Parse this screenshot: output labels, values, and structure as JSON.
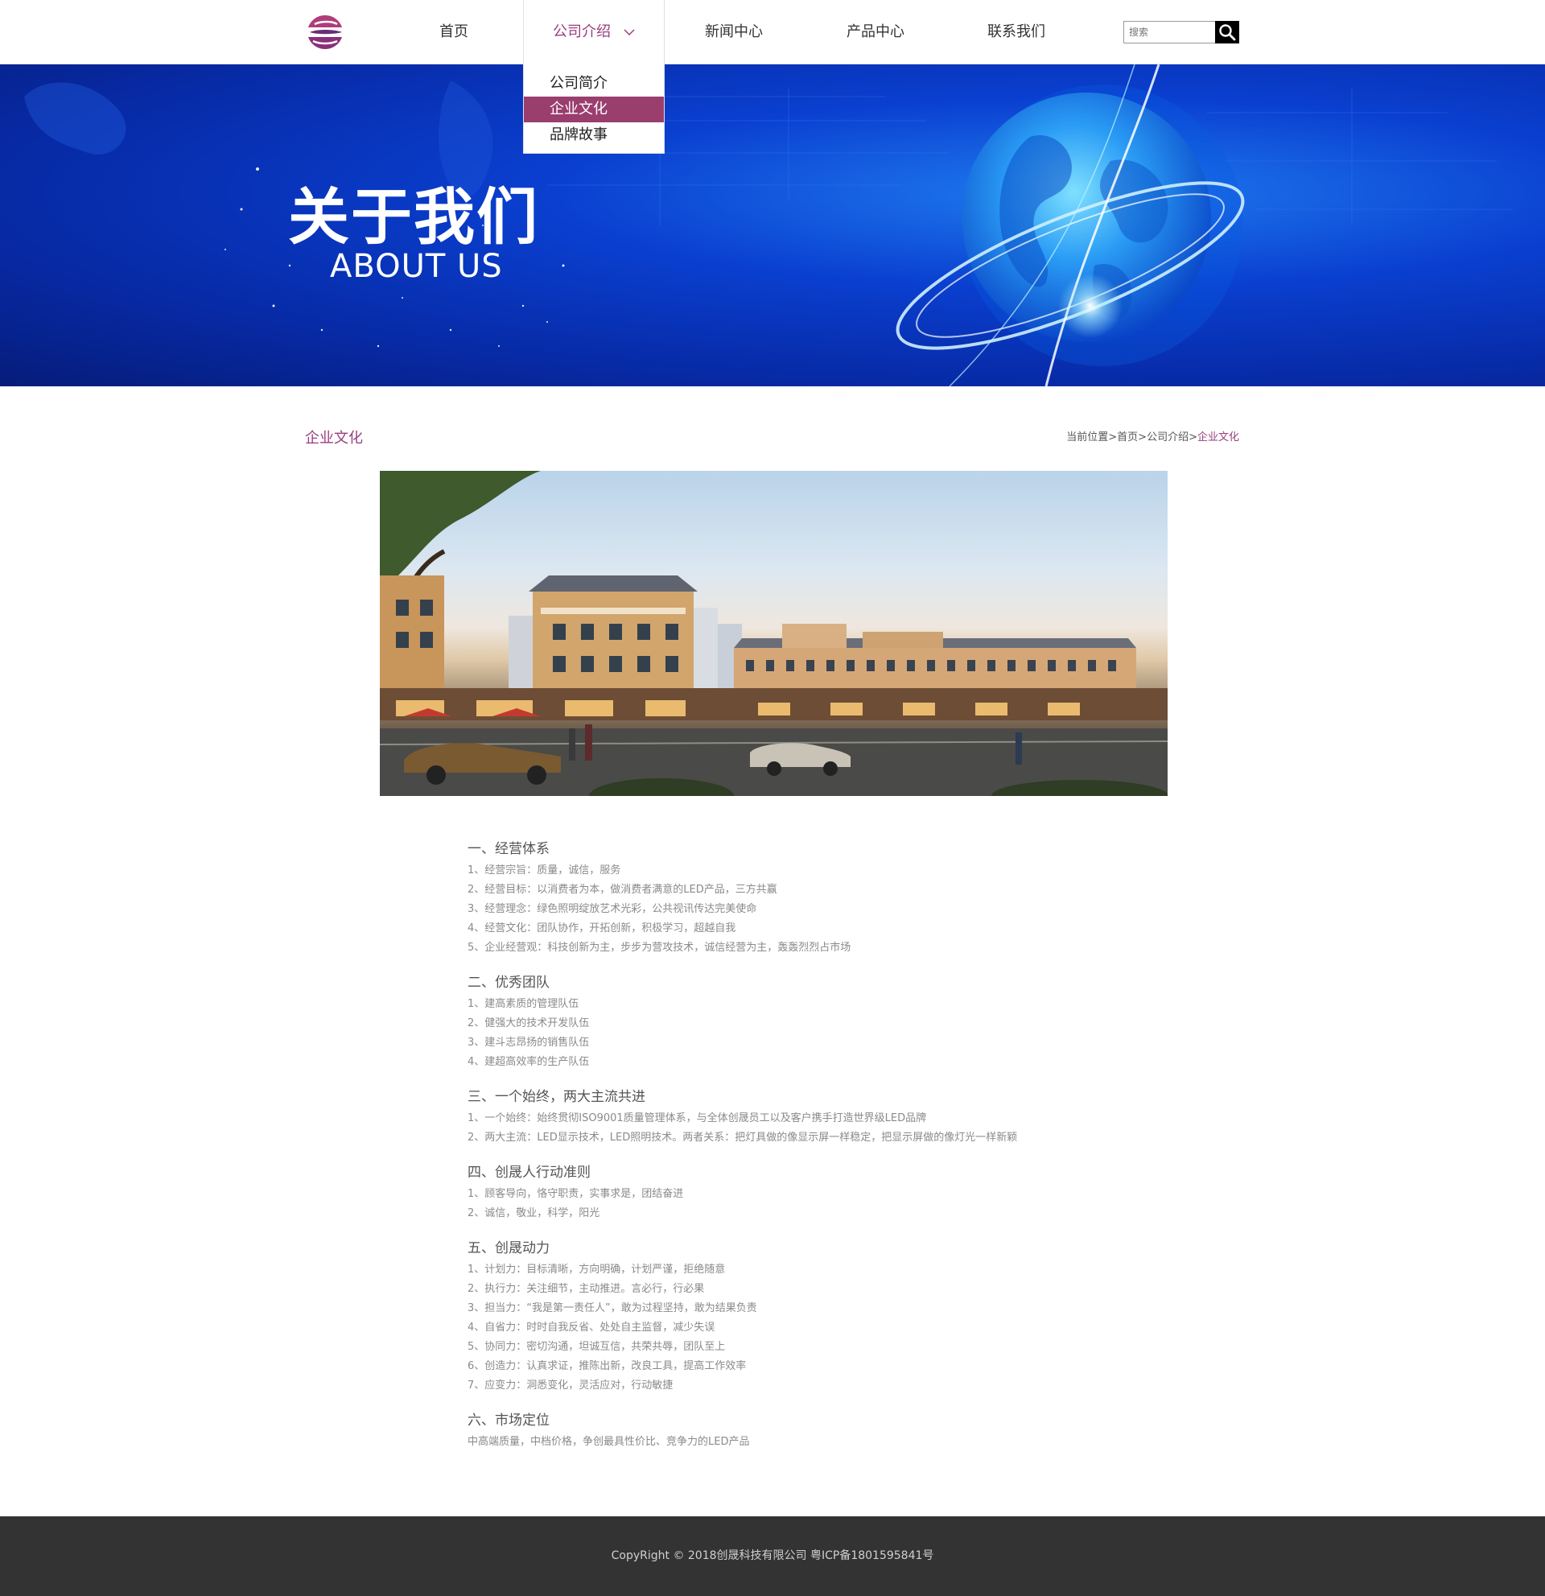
{
  "nav": {
    "items": [
      {
        "label": "首页"
      },
      {
        "label": "公司介绍"
      },
      {
        "label": "新闻中心"
      },
      {
        "label": "产品中心"
      },
      {
        "label": "联系我们"
      }
    ],
    "active_index": 1,
    "search_placeholder": "搜索"
  },
  "dropdown": {
    "items": [
      {
        "label": "公司简介"
      },
      {
        "label": "企业文化"
      },
      {
        "label": "品牌故事"
      }
    ],
    "active_index": 1
  },
  "banner": {
    "title": "关于我们",
    "subtitle": "ABOUT US"
  },
  "section": {
    "title": "企业文化",
    "breadcrumb": {
      "prefix": "当前位置",
      "home": "首页",
      "parent": "公司介绍",
      "current": "企业文化",
      "separator": ">"
    }
  },
  "content": {
    "blocks": [
      {
        "heading": "一、经营体系",
        "lines": [
          "1、经营宗旨：质量，诚信，服务",
          "2、经营目标：以消费者为本，做消费者满意的LED产品，三方共赢",
          "3、经营理念：绿色照明绽放艺术光彩，公共视讯传达完美使命",
          "4、经营文化：团队协作，开拓创新，积极学习，超越自我",
          "5、企业经营观：科技创新为主，步步为营攻技术，诚信经营为主，轰轰烈烈占市场"
        ]
      },
      {
        "heading": "二、优秀团队",
        "lines": [
          "1、建高素质的管理队伍",
          "2、健强大的技术开发队伍",
          "3、建斗志昂扬的销售队伍",
          "4、建超高效率的生产队伍"
        ]
      },
      {
        "heading": "三、一个始终，两大主流共进",
        "lines": [
          "1、一个始终：始终贯彻ISO9001质量管理体系，与全体创晟员工以及客户携手打造世界级LED品牌",
          "2、两大主流：LED显示技术，LED照明技术。两者关系：把灯具做的像显示屏一样稳定，把显示屏做的像灯光一样新颖"
        ]
      },
      {
        "heading": "四、创晟人行动准则",
        "lines": [
          "1、顾客导向，恪守职责，实事求是，团结奋进",
          "2、诚信，敬业，科学，阳光"
        ]
      },
      {
        "heading": "五、创晟动力",
        "lines": [
          "1、计划力：目标清晰，方向明确，计划严谨，拒绝随意",
          "2、执行力：关注细节，主动推进。言必行，行必果",
          "3、担当力：“我是第一责任人”，敢为过程坚持，敢为结果负责",
          "4、自省力：时时自我反省、处处自主监督，减少失误",
          "5、协同力：密切沟通，坦诚互信，共荣共辱，团队至上",
          "6、创造力：认真求证，推陈出新，改良工具，提高工作效率",
          "7、应变力：洞悉变化，灵活应对，行动敏捷"
        ]
      },
      {
        "heading": "六、市场定位",
        "lines": [
          "中高端质量，中档价格，争创最具性价比、竞争力的LED产品"
        ]
      }
    ]
  },
  "footer": {
    "text": "CopyRight © 2018创晟科技有限公司 粤ICP备1801595841号"
  },
  "colors": {
    "accent": "#9a3e7f",
    "dropdown_active": "#9a3e6e",
    "banner_blue": "#0a3fcf",
    "footer_bg": "#333333"
  },
  "icons": {
    "logo": "brand-logo-icon",
    "search": "search-icon",
    "chevron": "chevron-down-icon"
  }
}
